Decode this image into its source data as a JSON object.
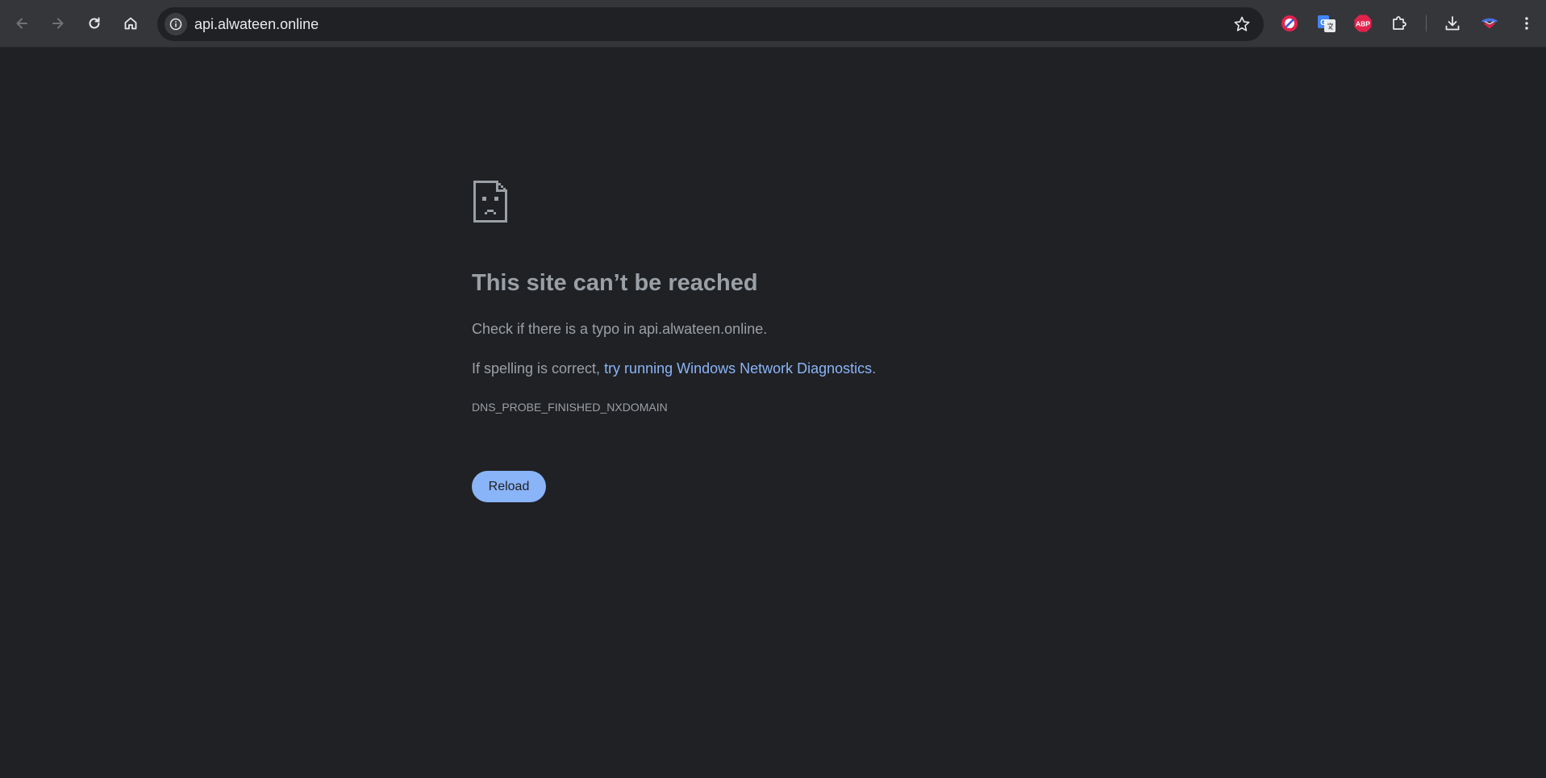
{
  "browser": {
    "url": "api.alwateen.online",
    "nav_icons": [
      "back-arrow-icon",
      "forward-arrow-icon",
      "reload-icon",
      "home-icon"
    ],
    "extensions": [
      "blocker-extension-icon",
      "google-translate-icon",
      "adblock-plus-icon",
      "extensions-puzzle-icon"
    ],
    "abp_label": "ABP",
    "translate_label": "G"
  },
  "error_page": {
    "title": "This site can’t be reached",
    "typo_message": "Check if there is a typo in api.alwateen.online.",
    "spelling_prefix": "If spelling is correct, ",
    "diagnostics_link": "try running Windows Network Diagnostics",
    "spelling_suffix": ".",
    "error_code": "DNS_PROBE_FINISHED_NXDOMAIN",
    "reload_label": "Reload"
  },
  "colors": {
    "background": "#202124",
    "toolbar": "#35363a",
    "text": "#9aa0a6",
    "link": "#8ab4f8",
    "button": "#8ab4f8"
  }
}
